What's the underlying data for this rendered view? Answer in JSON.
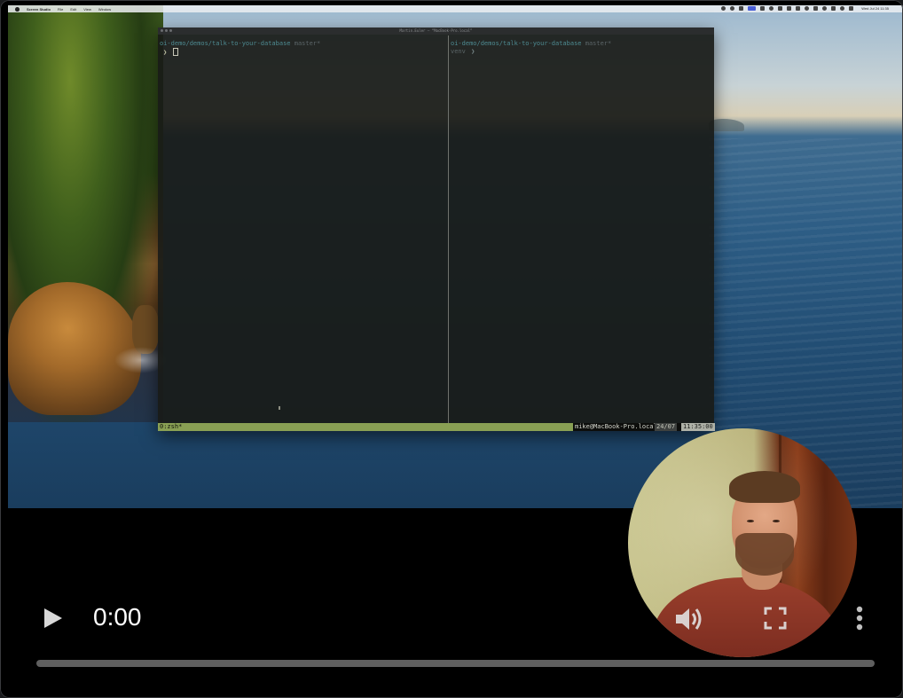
{
  "menubar": {
    "app_name": "Screen Studio",
    "items": [
      "File",
      "Edit",
      "View",
      "Window"
    ],
    "datetime": "Wed Jul 24  11:35"
  },
  "terminal": {
    "title": "Martin.Euler — “MacBook-Pro.local”",
    "left_pane": {
      "path": "oi-demo/demos/talk-to-your-database",
      "branch": "master*",
      "prompt": "❯"
    },
    "right_pane": {
      "path": "oi-demo/demos/talk-to-your-database",
      "branch": "master*",
      "venv": "venv",
      "prompt": "❯"
    },
    "tmux": {
      "window": "0:zsh*",
      "host": "mike@MacBook-Pro.local",
      "date": "24/07",
      "time": "11:35:00"
    }
  },
  "player": {
    "time": "0:00",
    "progress": 0.0,
    "icons": {
      "play": "play-icon",
      "volume": "volume-icon",
      "fullscreen": "fullscreen-icon",
      "more": "more-vertical-icon"
    }
  }
}
